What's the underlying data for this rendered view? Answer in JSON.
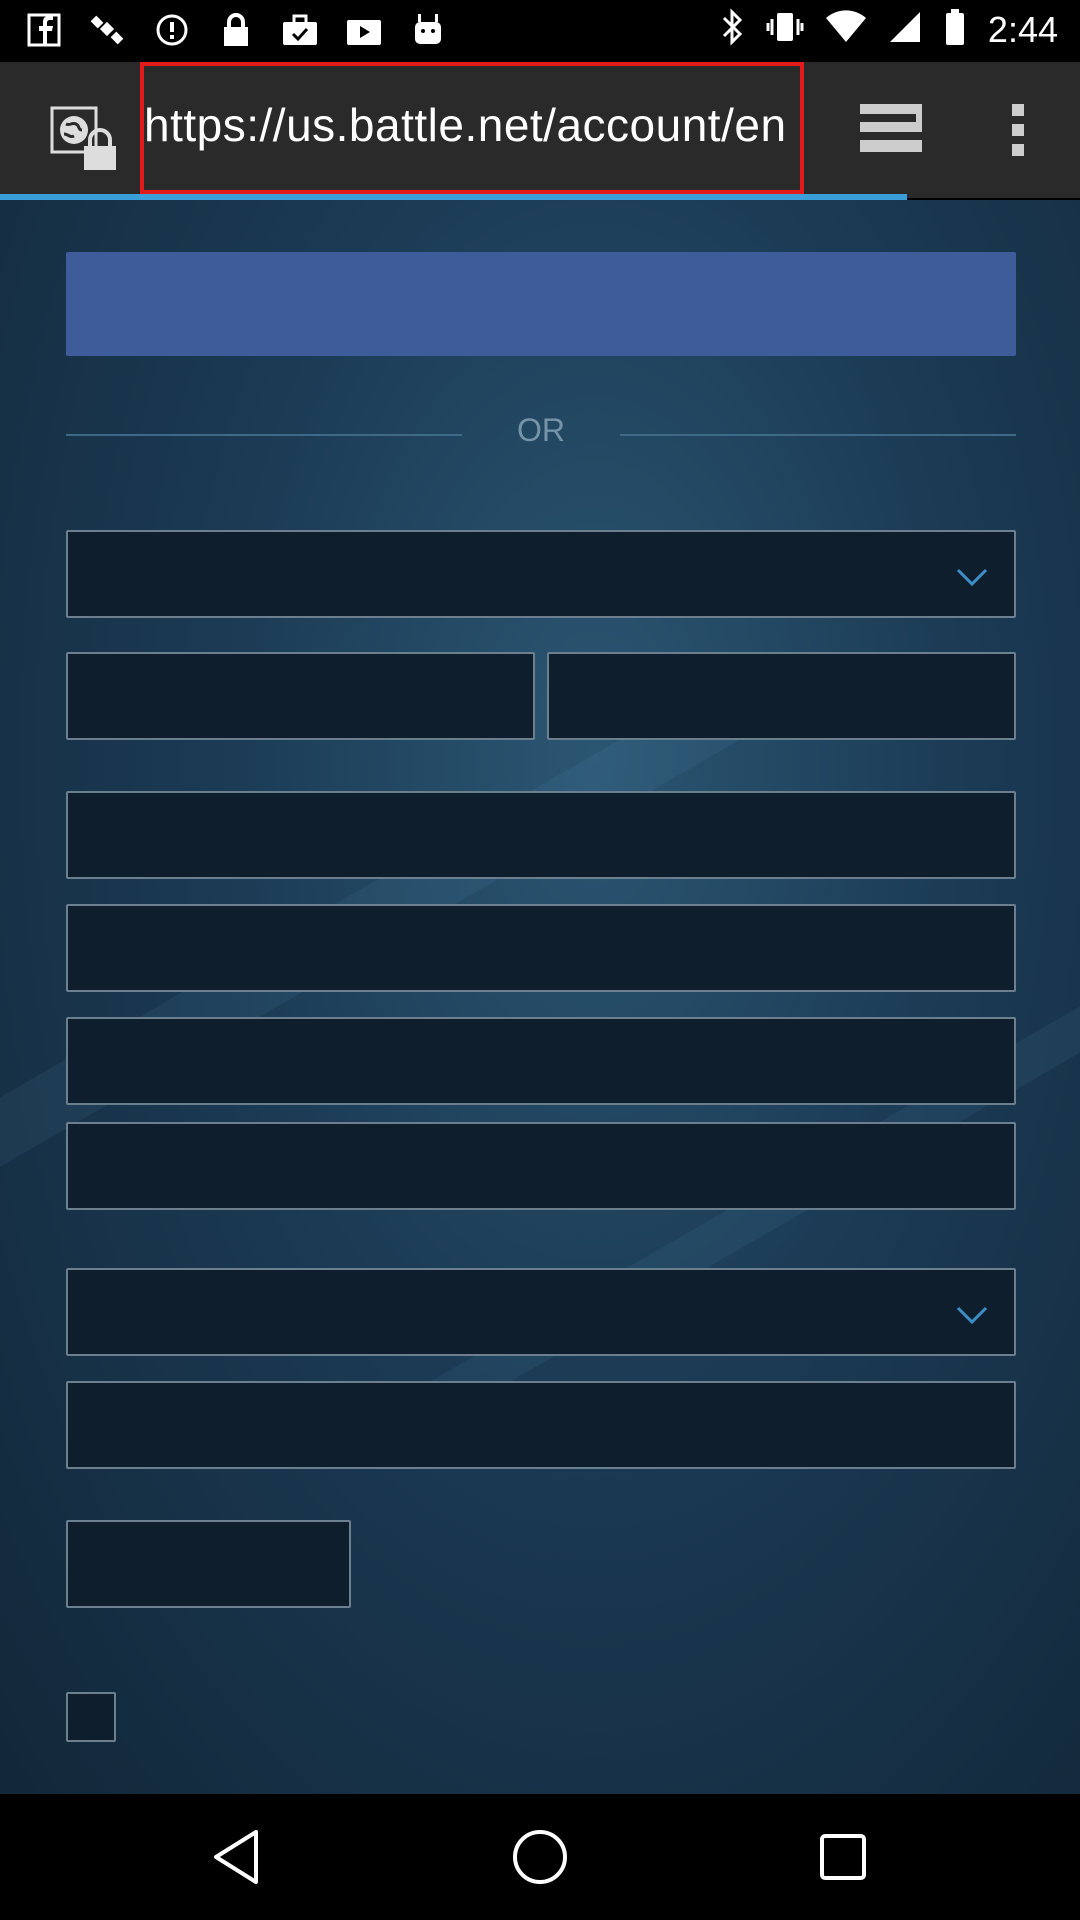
{
  "status_bar": {
    "time": "2:44",
    "left_icons": [
      "fb-icon",
      "satellite-icon",
      "data-saver-icon",
      "lock-icon",
      "briefcase-icon",
      "play-store-icon",
      "android-icon"
    ],
    "right_icons": [
      "bluetooth-icon",
      "vibrate-icon",
      "wifi-icon",
      "signal-icon",
      "battery-icon"
    ]
  },
  "browser": {
    "url": "https://us.battle.net/account/en",
    "page_load_progress": 0.84,
    "highlight_color": "#e31b1b"
  },
  "form": {
    "or_label": "OR",
    "primary_button_color": "#3e5c9a"
  },
  "nav": {
    "icons": [
      "back-icon",
      "home-icon",
      "recents-icon"
    ]
  }
}
